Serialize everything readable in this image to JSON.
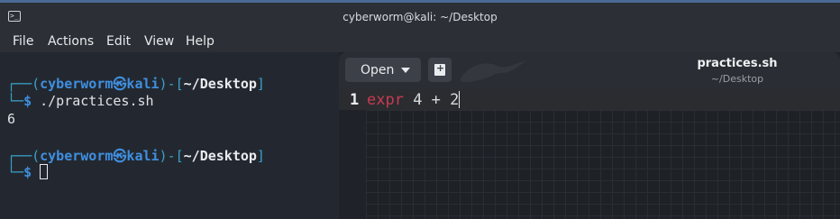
{
  "window": {
    "title": "cyberworm@kali: ~/Desktop",
    "icon": "terminal-icon"
  },
  "menu": [
    "File",
    "Actions",
    "Edit",
    "View",
    "Help"
  ],
  "terminal": {
    "prompt1": {
      "user": "cyberworm",
      "host": "kali",
      "path": "~/Desktop",
      "command": "./practices.sh"
    },
    "output": "6",
    "prompt2": {
      "user": "cyberworm",
      "host": "kali",
      "path": "~/Desktop",
      "command": ""
    }
  },
  "editor": {
    "open_label": "Open",
    "new_icon": "new-document-icon",
    "filename": "practices.sh",
    "filepath": "~/Desktop",
    "lines": [
      {
        "number": "1",
        "keyword": "expr",
        "rest": " 4 + 2"
      }
    ]
  },
  "colors": {
    "prompt_user": "#3f8fe0",
    "prompt_frame": "#3aa0c8",
    "keyword": "#c93a52",
    "accent": "#4a6a95"
  }
}
